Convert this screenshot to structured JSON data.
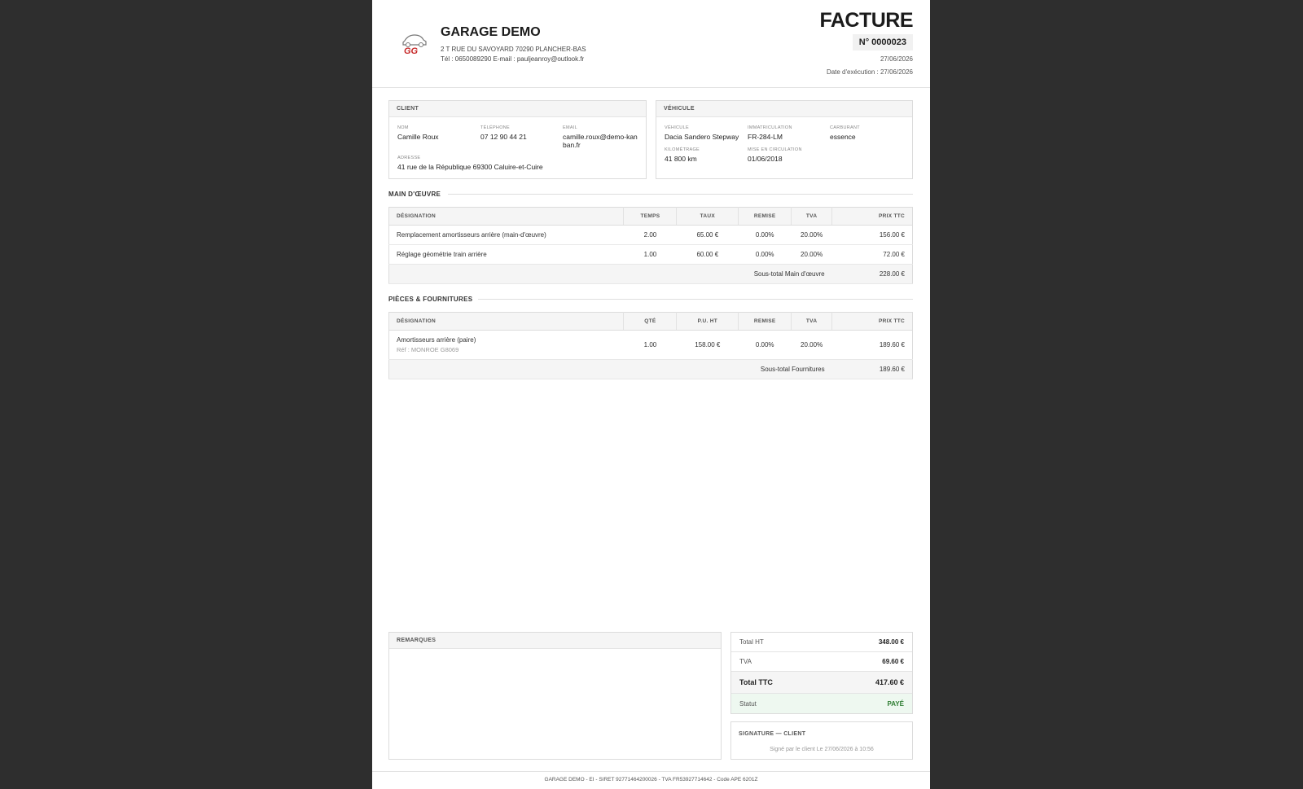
{
  "company": {
    "name": "GARAGE DEMO",
    "address": "2 T RUE DU SAVOYARD 70290 PLANCHER-BAS",
    "contact": "Tél : 0650089290 E-mail : pauljeanroy@outlook.fr",
    "logo_text": "GG"
  },
  "document": {
    "title": "FACTURE",
    "number": "N° 0000023",
    "date": "27/06/2026",
    "execution_date": "Date d'exécution : 27/06/2026"
  },
  "client": {
    "header": "CLIENT",
    "name_label": "NOM",
    "name": "Camille Roux",
    "phone_label": "TÉLÉPHONE",
    "phone": "07 12 90 44 21",
    "email_label": "EMAIL",
    "email": "camille.roux@demo-kanban.fr",
    "address_label": "ADRESSE",
    "address": "41 rue de la République 69300 Caluire-et-Cuire"
  },
  "vehicle": {
    "header": "VÉHICULE",
    "model_label": "VÉHICULE",
    "model": "Dacia Sandero Stepway",
    "plate_label": "IMMATRICULATION",
    "plate": "FR-284-LM",
    "fuel_label": "CARBURANT",
    "fuel": "essence",
    "mileage_label": "KILOMÉTRAGE",
    "mileage": "41 800 km",
    "registration_label": "MISE EN CIRCULATION",
    "registration": "01/06/2018"
  },
  "labor": {
    "title": "MAIN D'ŒUVRE",
    "columns": [
      "DÉSIGNATION",
      "TEMPS",
      "TAUX",
      "REMISE",
      "TVA",
      "PRIX TTC"
    ],
    "rows": [
      [
        "Remplacement amortisseurs arrière (main-d'œuvre)",
        "2.00",
        "65.00 €",
        "0.00%",
        "20.00%",
        "156.00 €"
      ],
      [
        "Réglage géométrie train arrière",
        "1.00",
        "60.00 €",
        "0.00%",
        "20.00%",
        "72.00 €"
      ]
    ],
    "subtotal_label": "Sous-total Main d'œuvre",
    "subtotal": "228.00 €"
  },
  "parts": {
    "title": "PIÈCES & FOURNITURES",
    "columns": [
      "DÉSIGNATION",
      "QTÉ",
      "P.U. HT",
      "REMISE",
      "TVA",
      "PRIX TTC"
    ],
    "rows": [
      {
        "name": "Amortisseurs arrière (paire)",
        "ref": "Réf : MONROE G8069",
        "qty": "1.00",
        "unit": "158.00 €",
        "discount": "0.00%",
        "vat": "20.00%",
        "total": "189.60 €"
      }
    ],
    "subtotal_label": "Sous-total Fournitures",
    "subtotal": "189.60 €"
  },
  "remarks": {
    "header": "REMARQUES"
  },
  "totals": {
    "ht_label": "Total HT",
    "ht": "348.00 €",
    "tva_label": "TVA",
    "tva": "69.60 €",
    "ttc_label": "Total TTC",
    "ttc": "417.60 €",
    "status_label": "Statut",
    "status": "PAYÉ",
    "status_color": "#2e7d32"
  },
  "signature": {
    "title": "SIGNATURE — CLIENT",
    "note": "Signé par le client Le 27/06/2026 à 10:56"
  },
  "footer": "GARAGE DEMO - EI - SIRET 92771464200026 - TVA FR53927714642 - Code APE 6201Z"
}
